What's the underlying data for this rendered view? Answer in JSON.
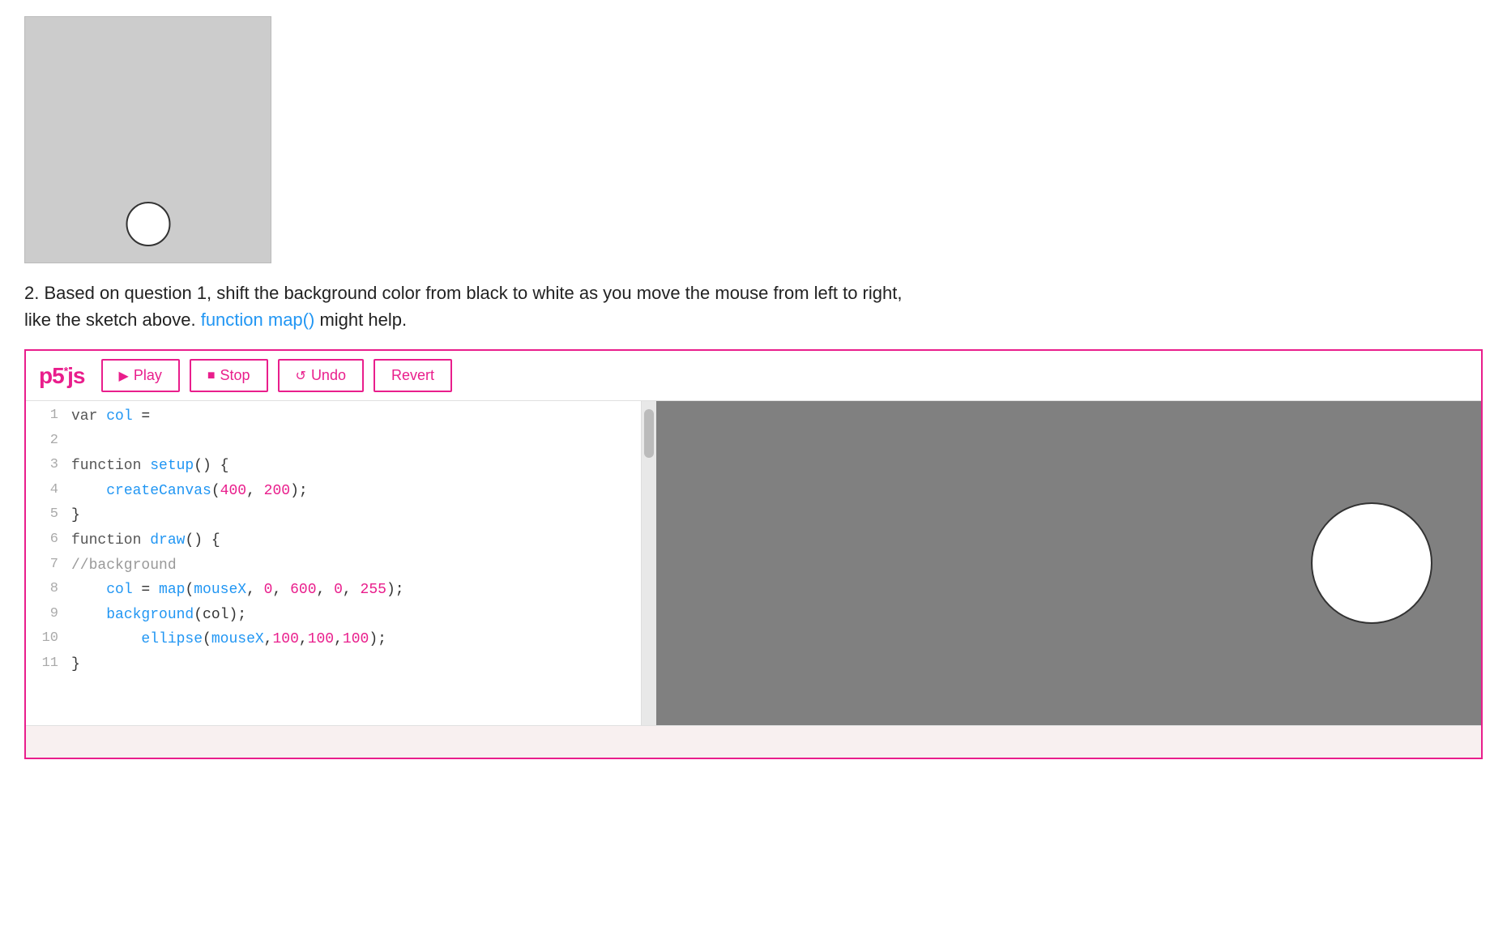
{
  "preview": {
    "canvas_bg": "#cccccc",
    "circle_color": "white"
  },
  "description": {
    "text": "2. Based on question 1, shift the background color from black to white as you move the mouse from left to right,",
    "text2": "like the sketch above.",
    "link_text": "function map()",
    "text3": "might help."
  },
  "toolbar": {
    "logo": "p5",
    "logo_suffix": "*js",
    "play_label": "Play",
    "stop_label": "Stop",
    "undo_label": "Undo",
    "revert_label": "Revert"
  },
  "code": {
    "lines": [
      {
        "num": "1",
        "html": "<span class='kw'>var </span><span class='var-name'>col</span><span class='plain'> =</span>"
      },
      {
        "num": "2",
        "html": ""
      },
      {
        "num": "3",
        "html": "<span class='kw'>function </span><span class='fn-name'>setup</span><span class='plain'>() {</span>"
      },
      {
        "num": "4",
        "html": "    <span class='fn-name'>createCanvas</span><span class='plain'>(</span><span class='num'>400</span><span class='plain'>, </span><span class='num'>200</span><span class='plain'>);</span>"
      },
      {
        "num": "5",
        "html": "<span class='plain'>}</span>"
      },
      {
        "num": "6",
        "html": "<span class='kw'>function </span><span class='fn-name'>draw</span><span class='plain'>() {</span>"
      },
      {
        "num": "7",
        "html": "<span class='comment'>//background</span>"
      },
      {
        "num": "8",
        "html": "    <span class='var-name'>col</span><span class='plain'> = </span><span class='fn-name'>map</span><span class='plain'>(</span><span class='var-name'>mouseX</span><span class='plain'>, </span><span class='num'>0</span><span class='plain'>, </span><span class='num'>600</span><span class='plain'>, </span><span class='num'>0</span><span class='plain'>, </span><span class='num'>255</span><span class='plain'>);</span>"
      },
      {
        "num": "9",
        "html": "    <span class='fn-name'>background</span><span class='plain'>(col);</span>"
      },
      {
        "num": "10",
        "html": "        <span class='fn-name'>ellipse</span><span class='plain'>(</span><span class='var-name'>mouseX</span><span class='plain'>,</span><span class='num'>100</span><span class='plain'>,</span><span class='num'>100</span><span class='plain'>,</span><span class='num'>100</span><span class='plain'>);</span>"
      },
      {
        "num": "11",
        "html": "<span class='plain'>}</span>"
      }
    ]
  },
  "output": {
    "canvas_bg": "#808080"
  }
}
